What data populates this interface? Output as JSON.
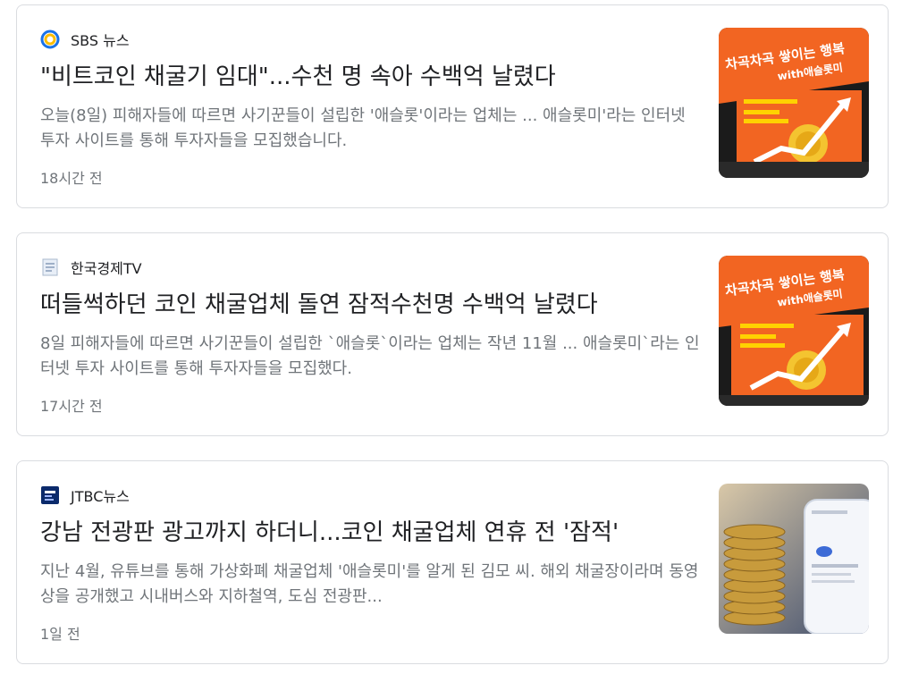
{
  "articles": [
    {
      "source": "SBS 뉴스",
      "logo_icon": "sbs-logo-icon",
      "headline": "\"비트코인 채굴기 임대\"...수천 명 속아 수백억 날렸다",
      "snippet": "오늘(8일) 피해자들에 따르면 사기꾼들이 설립한 '애슬롯'이라는 업체는 ... 애슬롯미'라는 인터넷 투자 사이트를 통해 투자자들을 모집했습니다.",
      "time": "18시간 전",
      "thumb_text_1": "차곡차곡 쌓이는 행복",
      "thumb_text_2": "with애슬롯미"
    },
    {
      "source": "한국경제TV",
      "logo_icon": "document-logo-icon",
      "headline": "떠들썩하던 코인 채굴업체 돌연 잠적수천명 수백억 날렸다",
      "snippet": "8일 피해자들에 따르면 사기꾼들이 설립한 `애슬롯`이라는 업체는 작년 11월 ... 애슬롯미`라는 인터넷 투자 사이트를 통해 투자자들을 모집했다.",
      "time": "17시간 전",
      "thumb_text_1": "차곡차곡 쌓이는 행복",
      "thumb_text_2": "with애슬롯미"
    },
    {
      "source": "JTBC뉴스",
      "logo_icon": "jtbc-logo-icon",
      "headline": "강남 전광판 광고까지 하더니...코인 채굴업체 연휴 전 '잠적'",
      "snippet": "지난 4월, 유튜브를 통해 가상화폐 채굴업체 '애슬롯미'를 알게 된 김모 씨. 해외 채굴장이라며 동영상을 공개했고 시내버스와 지하철역, 도심 전광판...",
      "time": "1일 전"
    }
  ],
  "colors": {
    "border": "#dadce0",
    "headline": "#202124",
    "snippet": "#70757a",
    "sbs_logo_blue": "#1a73e8",
    "sbs_logo_yellow": "#fbbc04",
    "jtbc_logo": "#0b2a6b",
    "billboard_orange": "#f26522"
  }
}
